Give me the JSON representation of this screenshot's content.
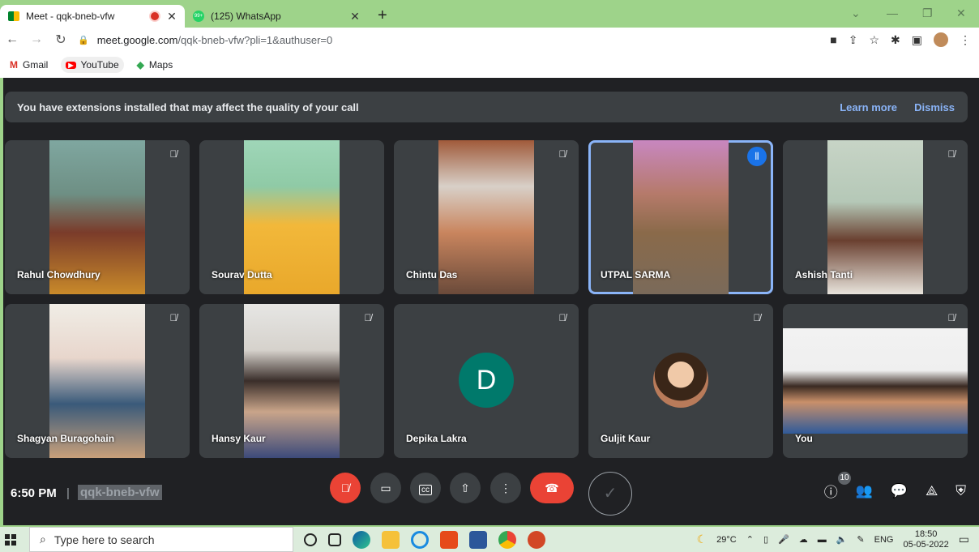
{
  "browser": {
    "tabs": [
      {
        "title": "Meet - qqk-bneb-vfw",
        "active": true
      },
      {
        "title": "(125) WhatsApp",
        "active": false
      }
    ],
    "url_host": "meet.google.com",
    "url_path": "/qqk-bneb-vfw?pli=1&authuser=0",
    "bookmarks": [
      "Gmail",
      "YouTube",
      "Maps"
    ]
  },
  "banner": {
    "message": "You have extensions installed that may affect the quality of your call",
    "learn_more": "Learn more",
    "dismiss": "Dismiss"
  },
  "participants": [
    {
      "name": "Rahul Chowdhury",
      "muted": true
    },
    {
      "name": "Sourav Dutta",
      "muted": false
    },
    {
      "name": "Chintu Das",
      "muted": true
    },
    {
      "name": "UTPAL SARMA",
      "speaking": true
    },
    {
      "name": "Ashish Tanti",
      "muted": true
    },
    {
      "name": "Shagyan Buragohain",
      "muted": true
    },
    {
      "name": "Hansy Kaur",
      "muted": true
    },
    {
      "name": "Depika Lakra",
      "muted": true,
      "initial": "D"
    },
    {
      "name": "Guljit Kaur",
      "muted": true
    },
    {
      "name": "You",
      "muted": true
    }
  ],
  "controls": {
    "time": "6:50 PM",
    "separator": "|",
    "meeting_code": "qqk-bneb-vfw",
    "participant_count": "10"
  },
  "taskbar": {
    "search_placeholder": "Type here to search",
    "temperature": "29°C",
    "language": "ENG",
    "clock_time": "18:50",
    "clock_date": "05-05-2022"
  },
  "colors": {
    "meet_bg": "#202124",
    "tile_bg": "#3c4043",
    "accent_blue": "#8ab4f8",
    "hangup_red": "#ea4335",
    "initial_teal": "#00796b"
  }
}
